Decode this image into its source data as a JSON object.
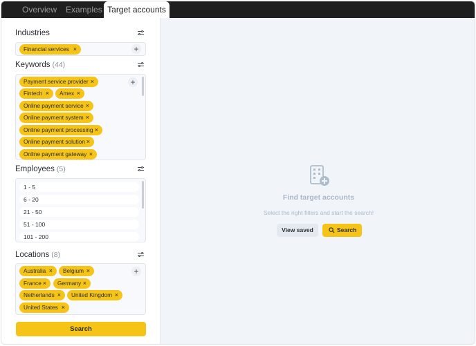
{
  "tabs": [
    {
      "label": "Overview",
      "active": false
    },
    {
      "label": "Examples",
      "active": false
    },
    {
      "label": "Target accounts",
      "active": true
    }
  ],
  "industries": {
    "title": "Industries",
    "chips": [
      "Financial services"
    ]
  },
  "keywords": {
    "title": "Keywords",
    "count": "(44)",
    "chips": [
      "Payment service provider",
      "Fintech",
      "Amex",
      "Online payment service",
      "Online payment system",
      "Online payment processing",
      "Online payment solution",
      "Online payment gateway"
    ]
  },
  "employees": {
    "title": "Employees",
    "count": "(5)",
    "options": [
      "1 - 5",
      "6 - 20",
      "21 - 50",
      "51 - 100",
      "101 - 200"
    ]
  },
  "locations": {
    "title": "Locations",
    "count": "(8)",
    "chips": [
      "Australia",
      "Belgium",
      "France",
      "Germany",
      "Netherlands",
      "United Kingdom",
      "United States"
    ]
  },
  "left_search_label": "Search",
  "empty_state": {
    "title": "Find target accounts",
    "subtitle": "Select the right filters and start the search!",
    "view_saved_label": "View saved",
    "search_label": "Search"
  },
  "icons": {
    "filter": "sliders-icon",
    "add": "plus-icon",
    "remove": "close-icon",
    "building": "building-add-icon",
    "search": "search-icon"
  },
  "colors": {
    "accent": "#f6c417",
    "tabbar": "#1f1f1f",
    "panel_bg": "#f1f5f9",
    "muted_text": "#a9b8c8"
  }
}
